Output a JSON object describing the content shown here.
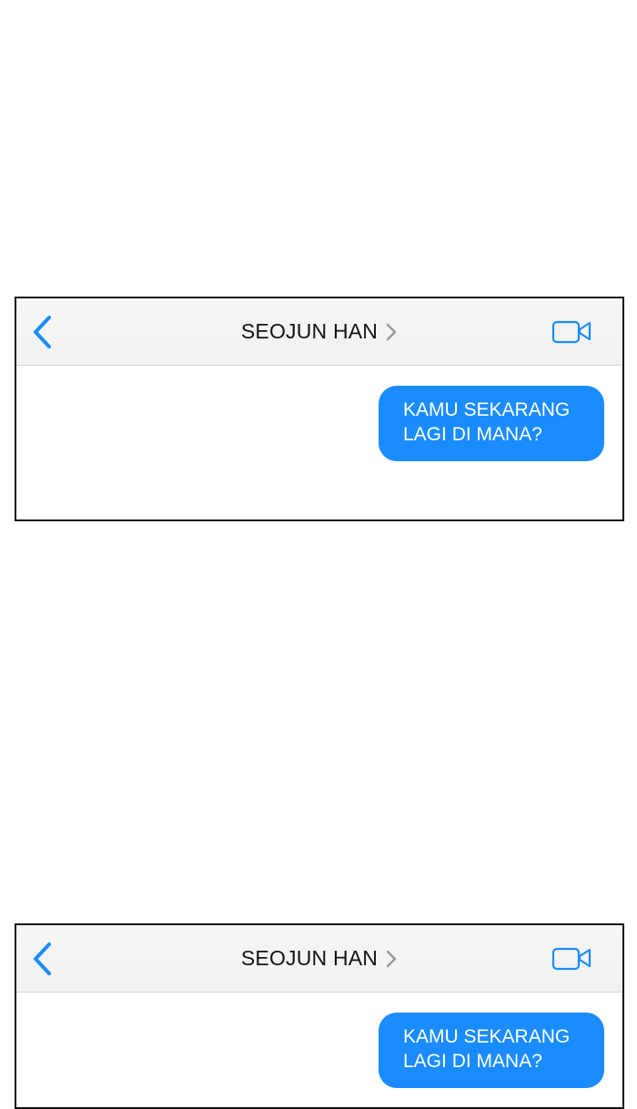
{
  "panels": [
    {
      "header": {
        "contact_name": "SEOJUN HAN",
        "back_icon": "chevron-left-icon",
        "disclosure_icon": "chevron-right-icon",
        "video_icon": "video-camera-icon"
      },
      "messages": [
        {
          "sender": "me",
          "lines": [
            "KAMU SEKARANG",
            "LAGI DI MANA?"
          ]
        }
      ]
    },
    {
      "header": {
        "contact_name": "SEOJUN HAN",
        "back_icon": "chevron-left-icon",
        "disclosure_icon": "chevron-right-icon",
        "video_icon": "video-camera-icon"
      },
      "messages": [
        {
          "sender": "me",
          "lines": [
            "KAMU SEKARANG",
            "LAGI DI MANA?"
          ]
        }
      ]
    }
  ],
  "colors": {
    "accent": "#1a8cff",
    "header_bg": "#f4f4f4",
    "bubble_text": "#ffffff",
    "border": "#111111"
  }
}
